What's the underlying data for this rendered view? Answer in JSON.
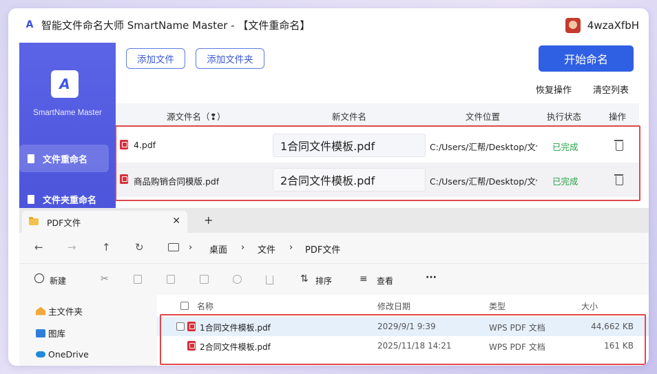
{
  "app": {
    "title": "智能文件命名大师 SmartName Master - 【文件重命名】",
    "user": "4wzaXfbH",
    "brand": "SmartName Master",
    "logo_glyph": "A"
  },
  "sidebar": {
    "items": [
      {
        "label": "文件重命名",
        "active": true
      },
      {
        "label": "文件夹重命名",
        "active": false
      }
    ]
  },
  "toolbar": {
    "add_file": "添加文件",
    "add_folder": "添加文件夹",
    "start": "开始命名",
    "restore": "恢复操作",
    "clear": "清空列表"
  },
  "table": {
    "headers": {
      "source": "源文件名（❢）",
      "new": "新文件名",
      "location": "文件位置",
      "status": "执行状态",
      "action": "操作"
    },
    "rows": [
      {
        "source": "4.pdf",
        "new": "1合同文件模板.pdf",
        "location": "C:/Users/汇帮/Desktop/文件",
        "status": "已完成"
      },
      {
        "source": "商品购销合同模版.pdf",
        "new": "2合同文件模板.pdf",
        "location": "C:/Users/汇帮/Desktop/文件",
        "status": "已完成"
      }
    ]
  },
  "explorer": {
    "tab_title": "PDF文件",
    "close": "✕",
    "plus": "+",
    "nav": {
      "back": "←",
      "forward": "→",
      "up": "↑",
      "refresh": "↻"
    },
    "breadcrumb": [
      "桌面",
      "文件",
      "PDF文件"
    ],
    "separator": "›",
    "toolbar": {
      "new": "新建",
      "sort": "排序",
      "view": "查看",
      "more": "···"
    },
    "nav_pane": [
      "主文件夹",
      "图库",
      "OneDrive"
    ],
    "columns": {
      "name": "名称",
      "modified": "修改日期",
      "type": "类型",
      "size": "大小"
    },
    "files": [
      {
        "name": "1合同文件模板.pdf",
        "modified": "2029/9/1 9:39",
        "type": "WPS PDF 文档",
        "size": "44,662 KB"
      },
      {
        "name": "2合同文件模板.pdf",
        "modified": "2025/11/18 14:21",
        "type": "WPS PDF 文档",
        "size": "161 KB"
      }
    ]
  },
  "colors": {
    "accent": "#2f5fe3",
    "sidebar": "#5159e0",
    "done": "#23a047",
    "highlight": "#e0474b",
    "pdf": "#d6303a"
  }
}
